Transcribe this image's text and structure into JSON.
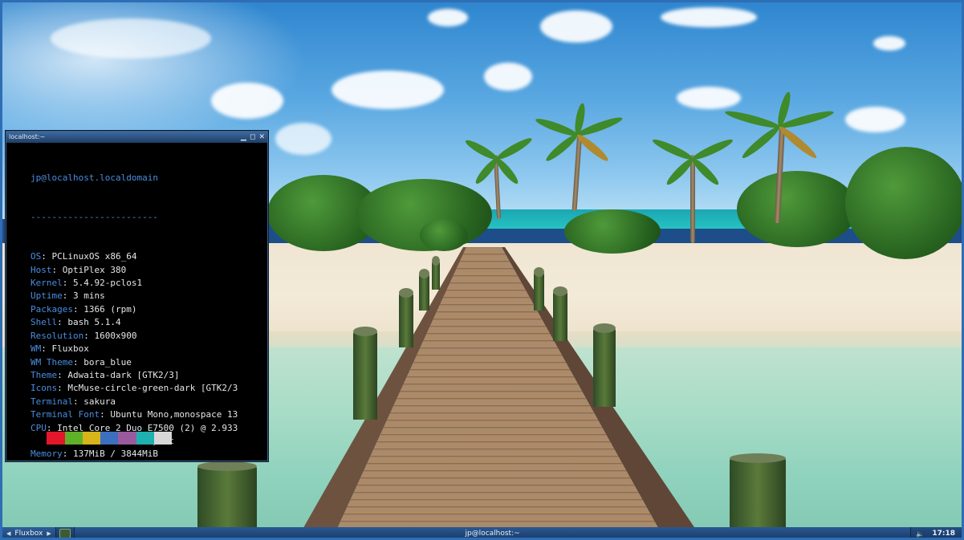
{
  "terminal": {
    "title": "localhost:~",
    "controls": {
      "minimize": "▁",
      "maximize": "◻",
      "close": "✕"
    },
    "user_host": "jp@localhost.localdomain",
    "separator": "------------------------",
    "info": [
      {
        "key": "OS",
        "value": "PCLinuxOS x86_64"
      },
      {
        "key": "Host",
        "value": "OptiPlex 380"
      },
      {
        "key": "Kernel",
        "value": "5.4.92-pclos1"
      },
      {
        "key": "Uptime",
        "value": "3 mins"
      },
      {
        "key": "Packages",
        "value": "1366 (rpm)"
      },
      {
        "key": "Shell",
        "value": "bash 5.1.4"
      },
      {
        "key": "Resolution",
        "value": "1600x900"
      },
      {
        "key": "WM",
        "value": "Fluxbox"
      },
      {
        "key": "WM Theme",
        "value": "bora_blue"
      },
      {
        "key": "Theme",
        "value": "Adwaita-dark [GTK2/3]"
      },
      {
        "key": "Icons",
        "value": "McMuse-circle-green-dark [GTK2/3"
      },
      {
        "key": "Terminal",
        "value": "sakura"
      },
      {
        "key": "Terminal Font",
        "value": "Ubuntu Mono,monospace 13"
      },
      {
        "key": "CPU",
        "value": "Intel Core 2 Duo E7500 (2) @ 2.933"
      },
      {
        "key": "GPU",
        "value": "Intel 4 Series Chipset"
      },
      {
        "key": "Memory",
        "value": "137MiB / 3844MiB"
      }
    ],
    "palette_dark": [
      "#000000",
      "#e4162a",
      "#5fb12a",
      "#d7b41a",
      "#3d6fc0",
      "#9a5a9e",
      "#1fb0b0",
      "#d8d8d8"
    ],
    "palette_bright": [
      "#606060",
      "#f23a3a",
      "#86dd3c",
      "#f4df3c",
      "#6da1e8",
      "#c080c0",
      "#3ee0e0",
      "#ffffff"
    ]
  },
  "taskbar": {
    "menu_label": "Fluxbox",
    "left_arrow": "◀",
    "right_arrow": "▶",
    "task_label": "jp@localhost:~",
    "volume_icon": "🔈",
    "clock": "17:18"
  },
  "colors": {
    "taskbar": "#1c416f",
    "terminal_bg": "#000000",
    "key_blue": "#4a8de0"
  }
}
